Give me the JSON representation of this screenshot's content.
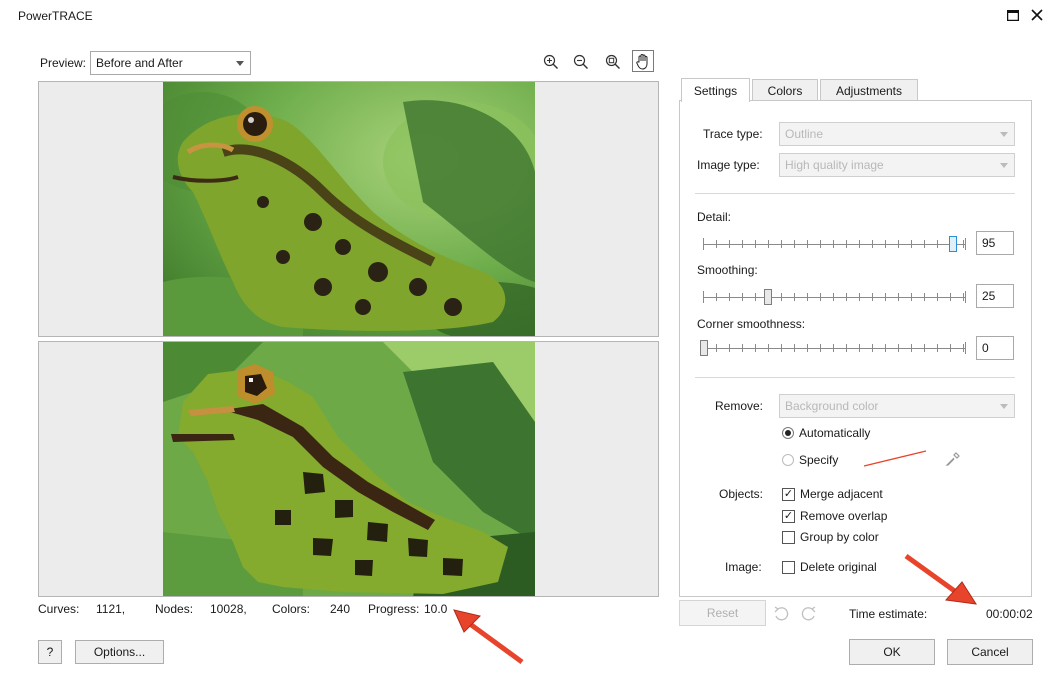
{
  "window": {
    "title": "PowerTRACE"
  },
  "preview": {
    "label": "Preview:",
    "mode": "Before and After",
    "tools": [
      "zoom-in-icon",
      "zoom-out-icon",
      "zoom-fit-icon",
      "pan-hand-icon"
    ]
  },
  "stats": {
    "curves_label": "Curves:",
    "curves_value": "1121,",
    "nodes_label": "Nodes:",
    "nodes_value": "10028,",
    "colors_label": "Colors:",
    "colors_value": "240",
    "progress_label": "Progress:",
    "progress_value": "10.0"
  },
  "tabs": [
    "Settings",
    "Colors",
    "Adjustments"
  ],
  "settings": {
    "trace_type_label": "Trace type:",
    "trace_type_value": "Outline",
    "image_type_label": "Image type:",
    "image_type_value": "High quality image",
    "detail_label": "Detail:",
    "detail_value": "95",
    "smoothing_label": "Smoothing:",
    "smoothing_value": "25",
    "corner_label": "Corner smoothness:",
    "corner_value": "0",
    "remove_label": "Remove:",
    "remove_value": "Background color",
    "auto_label": "Automatically",
    "specify_label": "Specify",
    "objects_label": "Objects:",
    "merge_label": "Merge adjacent",
    "overlap_label": "Remove overlap",
    "group_label": "Group by color",
    "image_label": "Image:",
    "delete_label": "Delete original"
  },
  "footer": {
    "reset_label": "Reset",
    "time_label": "Time estimate:",
    "time_value": "00:00:02",
    "help_label": "?",
    "options_label": "Options...",
    "ok_label": "OK",
    "cancel_label": "Cancel"
  },
  "colors": {
    "accent": "#2b8ed6",
    "annotation_arrow": "#e8442c"
  }
}
